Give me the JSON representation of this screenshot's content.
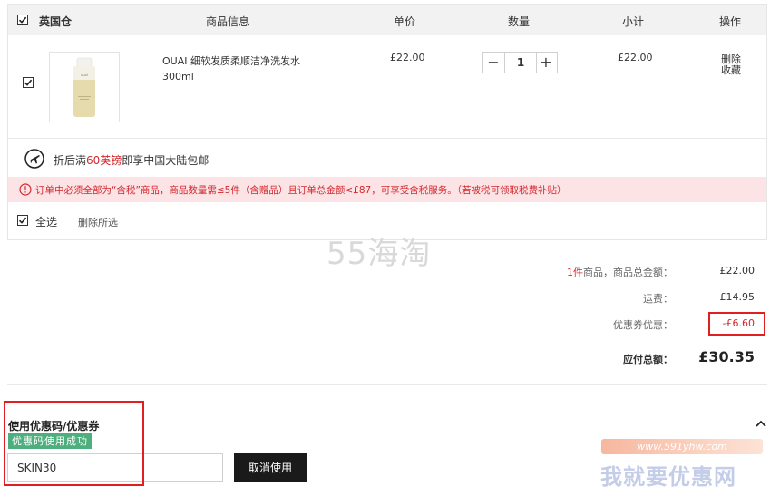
{
  "header": {
    "warehouse": "英国仓",
    "col_info": "商品信息",
    "col_price": "单价",
    "col_qty": "数量",
    "col_subtotal": "小计",
    "col_action": "操作"
  },
  "item": {
    "name_line1": "OUAI 细软发质柔顺洁净洗发水",
    "name_line2": "300ml",
    "price": "£22.00",
    "qty": "1",
    "qty_minus": "−",
    "qty_plus": "+",
    "subtotal": "£22.00",
    "delete": "删除",
    "favorite": "收藏",
    "thumb_brand": "ouai"
  },
  "shipping_note": {
    "prefix": "折后满",
    "amount": "60英镑",
    "suffix": "即享中国大陆包邮"
  },
  "tax_warning": "订单中必须全部为“含税”商品，商品数量需≤5件（含赠品）且订单总金额<£87，可享受含税服务。（若被税可领取税费补贴）",
  "footer": {
    "select_all": "全选",
    "delete_selected": "删除所选"
  },
  "watermark": "55海淘",
  "summary": {
    "count": "1件",
    "items_total_label": "商品，商品总金额：",
    "items_total": "£22.00",
    "shipping_label": "运费：",
    "shipping": "£14.95",
    "coupon_label": "优惠券优惠：",
    "coupon": "-£6.60",
    "total_label": "应付总额：",
    "total": "£30.35"
  },
  "coupon": {
    "title": "使用优惠码/优惠券",
    "success": "优惠码使用成功",
    "code": "SKIN30",
    "cancel": "取消使用"
  },
  "site_mark": {
    "url": "www.591yhw.com",
    "name": "我就要优惠网"
  },
  "colors": {
    "accent_red": "#d4282d",
    "success_green": "#4caf7d",
    "warning_bg": "#fbe3e6"
  }
}
